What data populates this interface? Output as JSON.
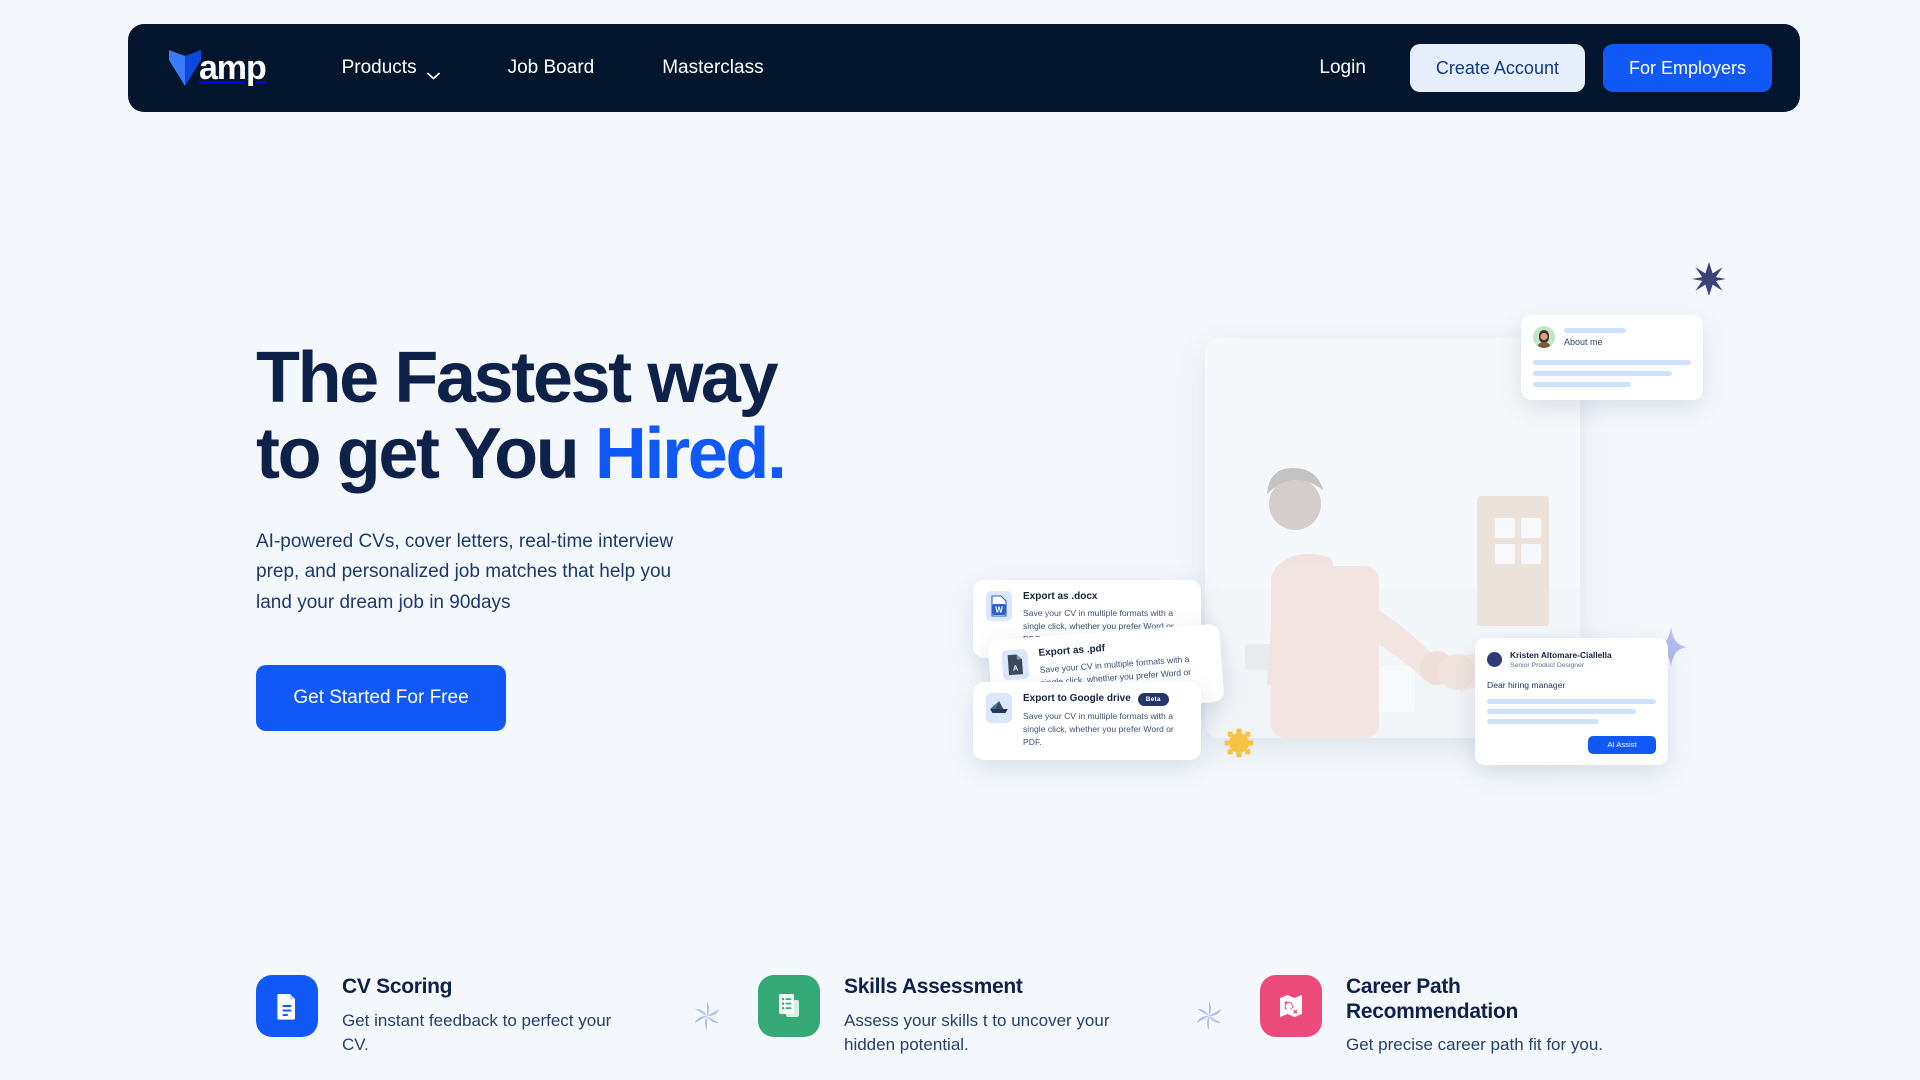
{
  "brand": {
    "name": "amp",
    "logo_icon": "vamp-v-logo",
    "logo_color_light": "#3b7bfa",
    "logo_color_dark": "#0b49de"
  },
  "colors": {
    "page_bg": "#f4f8fc",
    "navbar_bg": "#04162e",
    "primary": "#1159f7",
    "headline": "#0d2149",
    "accent_text": "#1159f7",
    "create_account_bg": "#e7eefb",
    "create_account_text": "#12397f",
    "cv_icon_bg": "#1159f7",
    "skills_icon_bg": "#34a877",
    "career_icon_bg": "#ec4a7b",
    "sparkle": "#aebdf0",
    "star": "#3b4278",
    "sunburst": "#f7c344"
  },
  "nav": {
    "links": [
      {
        "label": "Products",
        "has_dropdown": true,
        "icon": "chevron-down-icon"
      },
      {
        "label": "Job Board",
        "has_dropdown": false
      },
      {
        "label": "Masterclass",
        "has_dropdown": false
      }
    ],
    "login_label": "Login",
    "create_account_label": "Create Account",
    "for_employers_label": "For Employers"
  },
  "hero": {
    "headline_line1": "The Fastest way",
    "headline_line2_prefix": "to get You ",
    "headline_line2_accent": "Hired.",
    "subhead": "AI-powered CVs, cover letters, real-time interview prep, and personalized job matches that help you land your dream job in 90days",
    "cta_label": "Get Started For Free"
  },
  "hero_art": {
    "photo_alt": "handshake-office-photo",
    "export_cards": [
      {
        "title": "Export as .docx",
        "desc": "Save your CV in multiple formats with a single click, whether you prefer Word or PDF.",
        "icon": "word-doc-icon",
        "badge": ""
      },
      {
        "title": "Export as .pdf",
        "desc": "Save your CV in multiple formats with a single click, whether you prefer Word or PDF.",
        "icon": "pdf-doc-icon",
        "badge": ""
      },
      {
        "title": "Export to Google drive",
        "desc": "Save your CV in multiple formats with a single click, whether you prefer Word or PDF.",
        "icon": "google-drive-icon",
        "badge": "Beta"
      }
    ],
    "about_card": {
      "label": "About me",
      "avatar_icon": "user-avatar"
    },
    "cover_card": {
      "name": "Kristen Altomare-Ciallella",
      "role": "Senior Product Designer",
      "greeting": "Dear hiring manager",
      "ai_button_label": "AI Assist"
    },
    "decorations": [
      {
        "name": "star-burst-icon",
        "color": "#3b4278"
      },
      {
        "name": "sparkle-diamond-icon",
        "color": "#b6bdf0"
      },
      {
        "name": "sunburst-icon",
        "color": "#f7c344"
      }
    ]
  },
  "features": [
    {
      "title": "CV Scoring",
      "desc": "Get instant feedback to perfect your CV.",
      "icon": "document-score-icon",
      "icon_bg": "#1159f7"
    },
    {
      "title": "Skills Assessment",
      "desc": "Assess your skills t to uncover your hidden potential.",
      "icon": "checklist-icon",
      "icon_bg": "#34a877"
    },
    {
      "title": "Career Path Recommendation",
      "title_line1": "Career Path",
      "title_line2": "Recommendation",
      "desc": "Get precise career path fit for you.",
      "icon": "treasure-map-icon",
      "icon_bg": "#ec4a7b"
    }
  ],
  "separators": [
    {
      "name": "sparkle-asterisk-icon"
    },
    {
      "name": "sparkle-asterisk-icon"
    }
  ]
}
